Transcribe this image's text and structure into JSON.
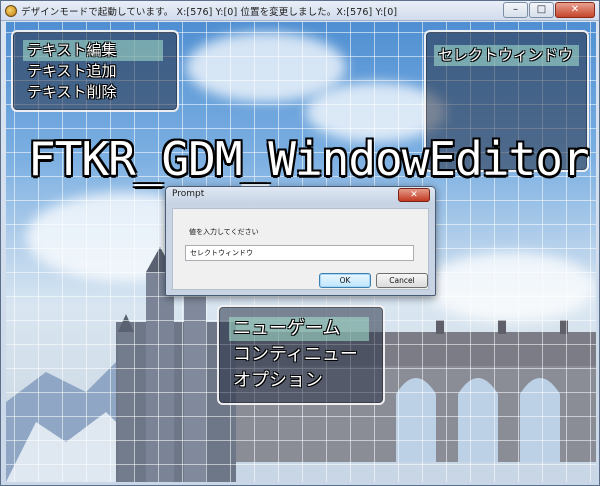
{
  "window": {
    "title": "デザインモードで起動しています。 X:[576] Y:[0] 位置を変更しました。X:[576] Y:[0]",
    "minimize_glyph": "–",
    "maximize_glyph": "□",
    "close_glyph": "✕"
  },
  "game": {
    "title_logo": "FTKR_GDM_WindowEditor",
    "text_menu": {
      "items": [
        {
          "label": "テキスト編集",
          "selected": true
        },
        {
          "label": "テキスト追加",
          "selected": false
        },
        {
          "label": "テキスト削除",
          "selected": false
        }
      ]
    },
    "select_window": {
      "label": "セレクトウィンドウ"
    },
    "title_command": {
      "items": [
        {
          "label": "ニューゲーム",
          "selected": true
        },
        {
          "label": "コンティニュー",
          "selected": false
        },
        {
          "label": "オプション",
          "selected": false
        }
      ]
    }
  },
  "prompt": {
    "title": "Prompt",
    "close_glyph": "✕",
    "message": "値を入力してください",
    "input_value": "セレクトウィンドウ",
    "ok_label": "OK",
    "cancel_label": "Cancel"
  },
  "colors": {
    "selection_highlight": "#9fd9c6",
    "window_border": "#ffffff",
    "dialog_close": "#c23a22"
  }
}
